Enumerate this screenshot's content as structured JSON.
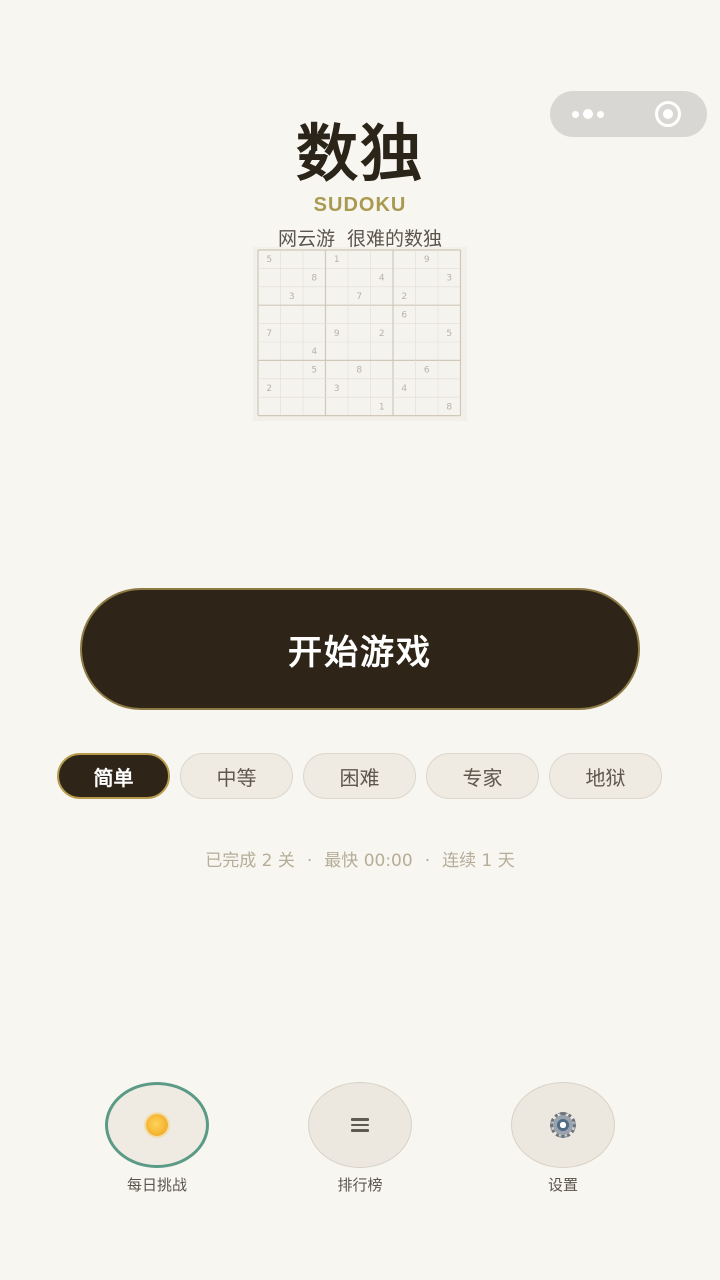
{
  "header": {
    "title": "数独",
    "subtitle": "SUDOKU",
    "tagline_part1": "网云游",
    "tagline_part2": "很难的数独"
  },
  "preview_grid": {
    "cells": [
      [
        5,
        0,
        0,
        1,
        0,
        0,
        0,
        9,
        0
      ],
      [
        0,
        0,
        8,
        0,
        0,
        4,
        0,
        0,
        3
      ],
      [
        0,
        3,
        0,
        0,
        7,
        0,
        2,
        0,
        0
      ],
      [
        0,
        0,
        0,
        0,
        0,
        0,
        6,
        0,
        0
      ],
      [
        7,
        0,
        0,
        9,
        0,
        2,
        0,
        0,
        5
      ],
      [
        0,
        0,
        4,
        0,
        0,
        0,
        0,
        0,
        0
      ],
      [
        0,
        0,
        5,
        0,
        8,
        0,
        0,
        6,
        0
      ],
      [
        2,
        0,
        0,
        3,
        0,
        0,
        4,
        0,
        0
      ],
      [
        0,
        0,
        0,
        0,
        0,
        1,
        0,
        0,
        8
      ]
    ]
  },
  "start_button": {
    "label": "开始游戏"
  },
  "difficulty": {
    "options": [
      "简单",
      "中等",
      "困难",
      "专家",
      "地狱"
    ],
    "selected": "简单"
  },
  "stats": {
    "completed": "已完成 2 关",
    "fastest": "最快 00:00",
    "streak": "连续 1 天",
    "separator": "·"
  },
  "bottom_nav": {
    "items": [
      {
        "label": "每日挑战",
        "icon": "sun-icon"
      },
      {
        "label": "排行榜",
        "icon": "menu-icon"
      },
      {
        "label": "设置",
        "icon": "gear-icon"
      }
    ]
  },
  "colors": {
    "background": "#f8f6f1",
    "primary_dark": "#2e2518",
    "accent_gold": "#a99a52",
    "active_teal": "#5b9a86"
  }
}
